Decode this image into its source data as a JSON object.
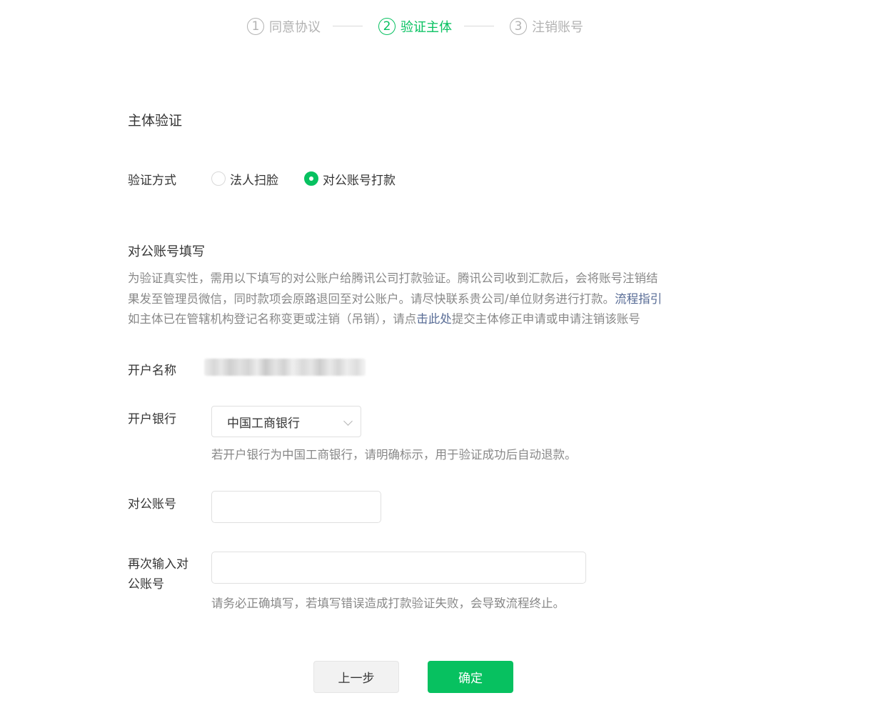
{
  "steps": [
    {
      "num": "1",
      "label": "同意协议",
      "active": false
    },
    {
      "num": "2",
      "label": "验证主体",
      "active": true
    },
    {
      "num": "3",
      "label": "注销账号",
      "active": false
    }
  ],
  "main": {
    "section_title": "主体验证",
    "verify_method_label": "验证方式",
    "radio_options": [
      {
        "label": "法人扫脸",
        "checked": false
      },
      {
        "label": "对公账号打款",
        "checked": true
      }
    ],
    "account_section_title": "对公账号填写",
    "desc": {
      "line1": "为验证真实性，需用以下填写的对公账户给腾讯公司打款验证。腾讯公司收到汇款后，会将账号注销结",
      "line2_text": "果发至管理员微信，同时款项会原路退回至对公账户。请尽快联系贵公司/单位财务进行打款。",
      "line2_link": "流程指引",
      "line3_pre": "如主体已在管辖机构登记名称变更或注销（吊销），请点",
      "line3_link": "击此处",
      "line3_post": "提交主体修正申请或申请注销该账号"
    },
    "account_name_label": "开户名称",
    "bank_label": "开户银行",
    "bank_selected": "中国工商银行",
    "bank_hint": "若开户银行为中国工商银行，请明确标示，用于验证成功后自动退款。",
    "account_number_label": "对公账号",
    "account_number_value": "",
    "repeat_label_line1": "再次输入对",
    "repeat_label_line2": "公账号",
    "repeat_value": "",
    "repeat_hint": "请务必正确填写，若填写错误造成打款验证失败，会导致流程终止。"
  },
  "buttons": {
    "prev": "上一步",
    "confirm": "确定"
  },
  "colors": {
    "accent": "#07c160",
    "link": "#576b95",
    "muted": "#888888"
  }
}
